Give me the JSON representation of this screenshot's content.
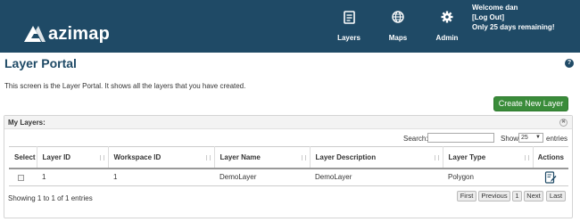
{
  "brand": {
    "logo_text": "azimap"
  },
  "nav": {
    "layers": {
      "label": "Layers",
      "icon": "layers-doc-icon"
    },
    "maps": {
      "label": "Maps",
      "icon": "globe-icon"
    },
    "admin": {
      "label": "Admin",
      "icon": "gear-icon"
    }
  },
  "user": {
    "welcome": "Welcome dan",
    "logout": "[Log Out]",
    "trial": "Only 25 days remaining!"
  },
  "page": {
    "title": "Layer Portal",
    "help": "?",
    "intro": "This screen is the Layer Portal. It shows all the layers that you have created.",
    "create_button": "Create New Layer"
  },
  "panel": {
    "title": "My Layers:",
    "search_label": "Search:",
    "search_value": "",
    "show_label": "Show",
    "show_value": "25",
    "entries_label": "entries",
    "columns": [
      "Select",
      "Layer ID",
      "Workspace ID",
      "Layer Name",
      "Layer Description",
      "Layer Type",
      "Actions"
    ],
    "rows": [
      {
        "layer_id": "1",
        "workspace_id": "1",
        "layer_name": "DemoLayer",
        "layer_description": "DemoLayer",
        "layer_type": "Polygon"
      }
    ],
    "info": "Showing 1 to 1 of 1 entries",
    "pagination": {
      "first": "First",
      "previous": "Previous",
      "page": "1",
      "next": "Next",
      "last": "Last"
    }
  }
}
